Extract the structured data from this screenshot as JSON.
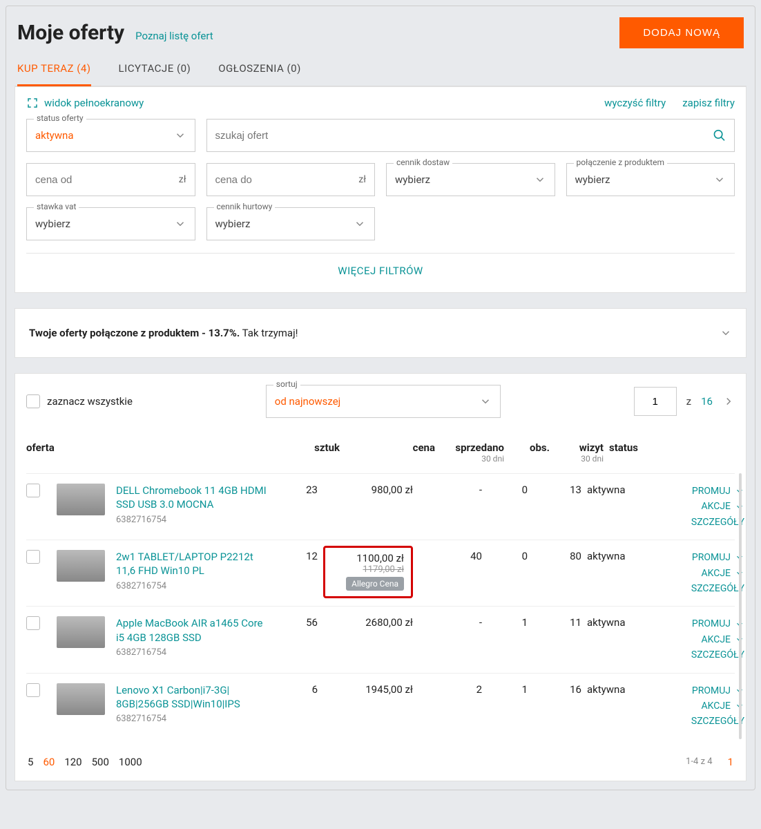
{
  "header": {
    "title": "Moje oferty",
    "learn_link": "Poznaj listę ofert",
    "add_button": "DODAJ NOWĄ"
  },
  "tabs": {
    "buy_now": "KUP TERAZ (4)",
    "auctions": "LICYTACJE (0)",
    "ads": "OGŁOSZENIA (0)"
  },
  "filters": {
    "fullscreen": "widok pełnoekranowy",
    "clear": "wyczyść filtry",
    "save": "zapisz filtry",
    "status_label": "status oferty",
    "status_value": "aktywna",
    "search_placeholder": "szukaj ofert",
    "price_from": "cena od",
    "price_to": "cena do",
    "currency": "zł",
    "delivery_label": "cennik dostaw",
    "product_link_label": "połączenie z produktem",
    "vat_label": "stawka vat",
    "wholesale_label": "cennik hurtowy",
    "choose": "wybierz",
    "more": "WIĘCEJ FILTRÓW"
  },
  "info": {
    "text_bold": "Twoje oferty połączone z produktem - 13.7%.",
    "text_rest": " Tak trzymaj!"
  },
  "listHeader": {
    "select_all": "zaznacz wszystkie",
    "sort_label": "sortuj",
    "sort_value": "od najnowszej",
    "page_value": "1",
    "page_sep": "z",
    "page_total": "16"
  },
  "columns": {
    "offer": "oferta",
    "qty": "sztuk",
    "price": "cena",
    "sold": "sprzedano",
    "sold_sub": "30 dni",
    "obs": "obs.",
    "visits": "wizyt",
    "visits_sub": "30 dni",
    "status": "status"
  },
  "actions": {
    "promote": "PROMUJ",
    "actions": "AKCJE",
    "details": "SZCZEGÓŁY"
  },
  "rows": [
    {
      "title": "DELL Chromebook 11 4GB HDMI SSD USB 3.0 MOCNA",
      "id": "6382716754",
      "qty": "23",
      "price": "980,00 zł",
      "sold": "-",
      "obs": "0",
      "visits": "13",
      "status": "aktywna",
      "highlighted": false
    },
    {
      "title": "2w1 TABLET/LAPTOP P2212t 11,6 FHD Win10 PL",
      "id": "6382716754",
      "qty": "12",
      "price": "1100,00 zł",
      "price_strike": "1179,00 zł",
      "badge": "Allegro Cena",
      "sold": "40",
      "obs": "0",
      "visits": "80",
      "status": "aktywna",
      "highlighted": true
    },
    {
      "title": "Apple MacBook AIR a1465 Core i5 4GB 128GB SSD",
      "id": "6382716754",
      "qty": "56",
      "price": "2680,00 zł",
      "sold": "-",
      "obs": "1",
      "visits": "11",
      "status": "aktywna",
      "highlighted": false
    },
    {
      "title": "Lenovo X1 Carbon|i7-3G| 8GB|256GB SSD|Win10|IPS",
      "id": "6382716754",
      "qty": "6",
      "price": "1945,00 zł",
      "sold": "2",
      "obs": "1",
      "visits": "16",
      "status": "aktywna",
      "highlighted": false
    }
  ],
  "footer": {
    "per_page": [
      "5",
      "60",
      "120",
      "500",
      "1000"
    ],
    "per_page_selected": "60",
    "range": "1-4 z 4",
    "current_page": "1"
  }
}
